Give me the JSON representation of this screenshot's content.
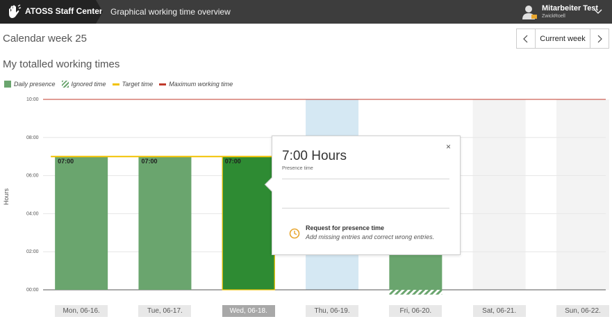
{
  "header": {
    "app_name": "ATOSS Staff Center",
    "page_title": "Graphical working time overview",
    "user_name": "Mitarbeiter Test",
    "user_org": "ZwickRoell"
  },
  "calendar": {
    "week_title": "Calendar week 25",
    "current_week_label": "Current week"
  },
  "totals_title": "My totalled working times",
  "legend": [
    {
      "label": "Daily presence",
      "swatch": "presence"
    },
    {
      "label": "Ignored time",
      "swatch": "ignored"
    },
    {
      "label": "Target time",
      "swatch": "target"
    },
    {
      "label": "Maximum working time",
      "swatch": "maximum"
    }
  ],
  "colors": {
    "presence": "#6aa56e",
    "presence_selected": "#2e8b33",
    "target": "#f2c200",
    "maximum": "#c0392b",
    "today_column": "#d5e8f3",
    "weekend_column": "#f3f3f3"
  },
  "popup": {
    "hours": "7:00 Hours",
    "subtitle": "Presence time",
    "close_icon": "×",
    "request_title": "Request for presence time",
    "request_desc": "Add missing entries and correct wrong entries."
  },
  "chart_data": {
    "type": "bar",
    "ylabel": "Hours",
    "ylim": [
      0,
      10
    ],
    "yticks": [
      "00:00",
      "02:00",
      "04:00",
      "06:00",
      "08:00",
      "10:00"
    ],
    "categories": [
      "Mon, 06-16.",
      "Tue, 06-17.",
      "Wed, 06-18.",
      "Thu, 06-19.",
      "Fri, 06-20.",
      "Sat, 06-21.",
      "Sun, 06-22."
    ],
    "series": [
      {
        "name": "Daily presence",
        "values": [
          7,
          7,
          7,
          0,
          2,
          0,
          0
        ],
        "data_labels": [
          "07:00",
          "07:00",
          "07:00",
          "",
          "",
          "",
          ""
        ]
      }
    ],
    "ignored_time": [
      0,
      0,
      0,
      0,
      0.25,
      0,
      0
    ],
    "target_time": [
      7,
      7,
      7,
      7,
      7,
      0,
      0
    ],
    "maximum_working_time": 10,
    "selected_category": "Wed, 06-18.",
    "today_category": "Thu, 06-19.",
    "weekend_categories": [
      "Sat, 06-21.",
      "Sun, 06-22."
    ]
  }
}
